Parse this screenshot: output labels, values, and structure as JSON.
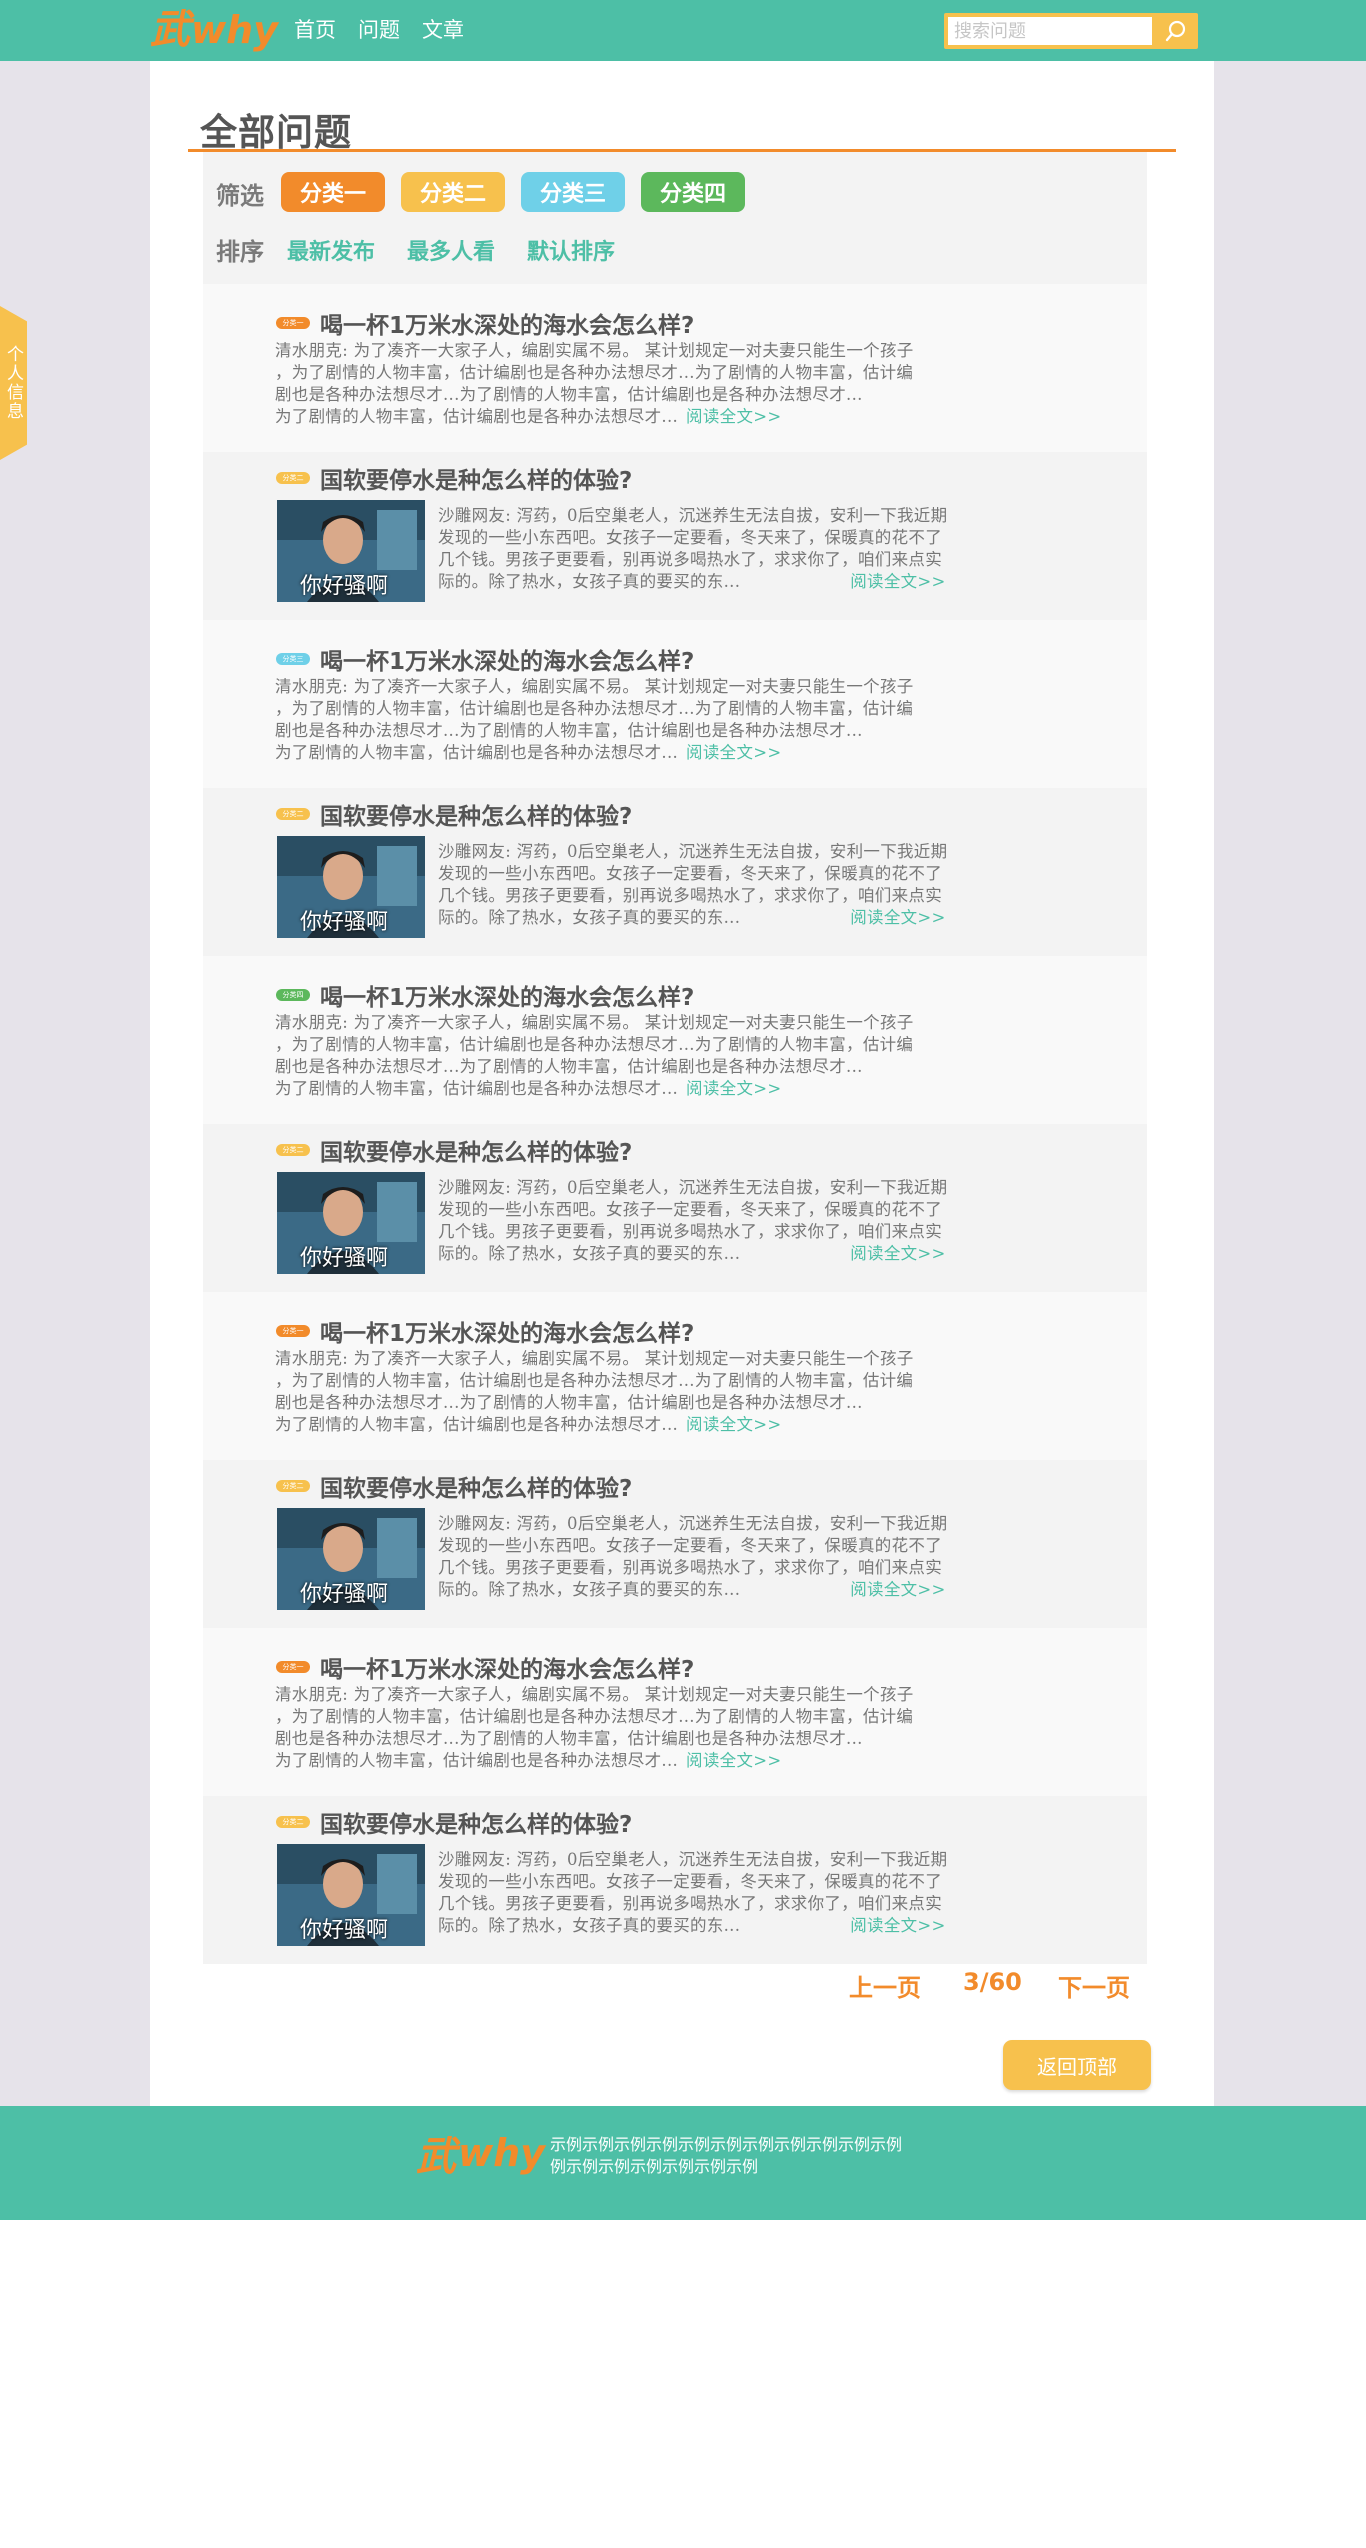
{
  "header": {
    "logo_mark": "武",
    "logo_why": "why",
    "nav": [
      "首页",
      "问题",
      "文章"
    ],
    "search_placeholder": "搜索问题"
  },
  "side_tab": "个人信息",
  "page_title": "全部问题",
  "filter": {
    "label": "筛选",
    "chips": [
      {
        "label": "分类一",
        "color": "#f28b2b"
      },
      {
        "label": "分类二",
        "color": "#f7c14d"
      },
      {
        "label": "分类三",
        "color": "#6fd0e8"
      },
      {
        "label": "分类四",
        "color": "#5cb85c"
      }
    ]
  },
  "sort": {
    "label": "排序",
    "options": [
      "最新发布",
      "最多人看",
      "默认排序"
    ]
  },
  "items": [
    {
      "type": "text",
      "badge": "分类一",
      "badge_color": "#f28b2b",
      "title": "喝一杯1万米水深处的海水会怎么样?",
      "lines": [
        "清水朋克:  为了凑齐一大家子人，编剧实属不易。 某计划规定一对夫妻只能生一个孩子",
        "，为了剧情的人物丰富，估计编剧也是各种办法想尽才...为了剧情的人物丰富，估计编",
        "剧也是各种办法想尽才...为了剧情的人物丰富，估计编剧也是各种办法想尽才...",
        "为了剧情的人物丰富，估计编剧也是各种办法想尽才..."
      ],
      "read_more": "阅读全文>>"
    },
    {
      "type": "image",
      "badge": "分类二",
      "badge_color": "#f7c14d",
      "title": "国软要停水是种怎么样的体验?",
      "image_caption": "你好骚啊",
      "lines": [
        "沙雕网友: 泻药，0后空巢老人，沉迷养生无法自拔，安利一下我近期",
        "发现的一些小东西吧。女孩子一定要看，冬天来了，保暖真的花不了",
        "几个钱。男孩子更要看，别再说多喝热水了，求求你了，咱们来点实",
        "际的。除了热水，女孩子真的要买的东..."
      ],
      "read_more": "阅读全文>>"
    },
    {
      "type": "text",
      "badge": "分类三",
      "badge_color": "#6fd0e8",
      "title": "喝一杯1万米水深处的海水会怎么样?",
      "lines": [
        "清水朋克:  为了凑齐一大家子人，编剧实属不易。 某计划规定一对夫妻只能生一个孩子",
        "，为了剧情的人物丰富，估计编剧也是各种办法想尽才...为了剧情的人物丰富，估计编",
        "剧也是各种办法想尽才...为了剧情的人物丰富，估计编剧也是各种办法想尽才...",
        "为了剧情的人物丰富，估计编剧也是各种办法想尽才..."
      ],
      "read_more": "阅读全文>>"
    },
    {
      "type": "image",
      "badge": "分类二",
      "badge_color": "#f7c14d",
      "title": "国软要停水是种怎么样的体验?",
      "image_caption": "你好骚啊",
      "lines": [
        "沙雕网友: 泻药，0后空巢老人，沉迷养生无法自拔，安利一下我近期",
        "发现的一些小东西吧。女孩子一定要看，冬天来了，保暖真的花不了",
        "几个钱。男孩子更要看，别再说多喝热水了，求求你了，咱们来点实",
        "际的。除了热水，女孩子真的要买的东..."
      ],
      "read_more": "阅读全文>>"
    },
    {
      "type": "text",
      "badge": "分类四",
      "badge_color": "#5cb85c",
      "title": "喝一杯1万米水深处的海水会怎么样?",
      "lines": [
        "清水朋克:  为了凑齐一大家子人，编剧实属不易。 某计划规定一对夫妻只能生一个孩子",
        "，为了剧情的人物丰富，估计编剧也是各种办法想尽才...为了剧情的人物丰富，估计编",
        "剧也是各种办法想尽才...为了剧情的人物丰富，估计编剧也是各种办法想尽才...",
        "为了剧情的人物丰富，估计编剧也是各种办法想尽才..."
      ],
      "read_more": "阅读全文>>"
    },
    {
      "type": "image",
      "badge": "分类二",
      "badge_color": "#f7c14d",
      "title": "国软要停水是种怎么样的体验?",
      "image_caption": "你好骚啊",
      "lines": [
        "沙雕网友: 泻药，0后空巢老人，沉迷养生无法自拔，安利一下我近期",
        "发现的一些小东西吧。女孩子一定要看，冬天来了，保暖真的花不了",
        "几个钱。男孩子更要看，别再说多喝热水了，求求你了，咱们来点实",
        "际的。除了热水，女孩子真的要买的东..."
      ],
      "read_more": "阅读全文>>"
    },
    {
      "type": "text",
      "badge": "分类一",
      "badge_color": "#f28b2b",
      "title": "喝一杯1万米水深处的海水会怎么样?",
      "lines": [
        "清水朋克:  为了凑齐一大家子人，编剧实属不易。 某计划规定一对夫妻只能生一个孩子",
        "，为了剧情的人物丰富，估计编剧也是各种办法想尽才...为了剧情的人物丰富，估计编",
        "剧也是各种办法想尽才...为了剧情的人物丰富，估计编剧也是各种办法想尽才...",
        "为了剧情的人物丰富，估计编剧也是各种办法想尽才..."
      ],
      "read_more": "阅读全文>>"
    },
    {
      "type": "image",
      "badge": "分类二",
      "badge_color": "#f7c14d",
      "title": "国软要停水是种怎么样的体验?",
      "image_caption": "你好骚啊",
      "lines": [
        "沙雕网友: 泻药，0后空巢老人，沉迷养生无法自拔，安利一下我近期",
        "发现的一些小东西吧。女孩子一定要看，冬天来了，保暖真的花不了",
        "几个钱。男孩子更要看，别再说多喝热水了，求求你了，咱们来点实",
        "际的。除了热水，女孩子真的要买的东..."
      ],
      "read_more": "阅读全文>>"
    },
    {
      "type": "text",
      "badge": "分类一",
      "badge_color": "#f28b2b",
      "title": "喝一杯1万米水深处的海水会怎么样?",
      "lines": [
        "清水朋克:  为了凑齐一大家子人，编剧实属不易。 某计划规定一对夫妻只能生一个孩子",
        "，为了剧情的人物丰富，估计编剧也是各种办法想尽才...为了剧情的人物丰富，估计编",
        "剧也是各种办法想尽才...为了剧情的人物丰富，估计编剧也是各种办法想尽才...",
        "为了剧情的人物丰富，估计编剧也是各种办法想尽才..."
      ],
      "read_more": "阅读全文>>"
    },
    {
      "type": "image",
      "badge": "分类二",
      "badge_color": "#f7c14d",
      "title": "国软要停水是种怎么样的体验?",
      "image_caption": "你好骚啊",
      "lines": [
        "沙雕网友: 泻药，0后空巢老人，沉迷养生无法自拔，安利一下我近期",
        "发现的一些小东西吧。女孩子一定要看，冬天来了，保暖真的花不了",
        "几个钱。男孩子更要看，别再说多喝热水了，求求你了，咱们来点实",
        "际的。除了热水，女孩子真的要买的东..."
      ],
      "read_more": "阅读全文>>"
    }
  ],
  "pager": {
    "prev": "上一页",
    "current": "3/60",
    "next": "下一页"
  },
  "back_to_top": "返回顶部",
  "footer": {
    "logo_mark": "武",
    "logo_why": "why",
    "text_line1": "示例示例示例示例示例示例示例示例示例示例示例",
    "text_line2": "例示例示例示例示例示例示例"
  }
}
